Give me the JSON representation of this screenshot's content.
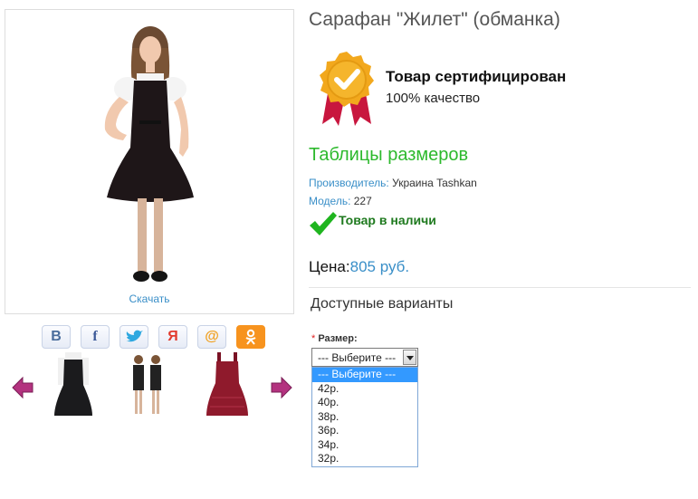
{
  "product": {
    "title": "Сарафан \"Жилет\" (обманка)",
    "download_label": "Скачать"
  },
  "certificate": {
    "title": "Товар сертифицирован",
    "subtitle": "100% качество",
    "icon": "certified-badge-icon"
  },
  "size_tables_link": "Таблицы размеров",
  "meta": {
    "manufacturer_label": "Производитель:",
    "manufacturer_value": "Украина Tashkan",
    "model_label": "Модель:",
    "model_value": "227"
  },
  "stock": {
    "text": "Товар в наличи",
    "icon": "checkmark-icon"
  },
  "price": {
    "label": "Цена:",
    "value": "805 руб."
  },
  "variants_title": "Доступные варианты",
  "size": {
    "required_mark": "*",
    "label": "Размер:",
    "selected": "--- Выберите ---",
    "options": [
      "--- Выберите ---",
      "42р.",
      "40р.",
      "38р.",
      "36р.",
      "34р.",
      "32р."
    ]
  },
  "share": [
    {
      "name": "vk",
      "glyph": "B",
      "color": "#4a6d9c"
    },
    {
      "name": "facebook",
      "glyph": "f",
      "color": "#3b5998"
    },
    {
      "name": "twitter",
      "glyph": "",
      "color": "#2fa8e0"
    },
    {
      "name": "my-world",
      "glyph": "Я",
      "color": "#e23b2e"
    },
    {
      "name": "mail",
      "glyph": "@",
      "color": "#f0a020"
    },
    {
      "name": "odnoklassniki",
      "glyph": "ОК",
      "color": "#f7931e"
    }
  ],
  "colors": {
    "accent": "#3a8fc8",
    "green": "#2db92d",
    "arrow": "#b3327f"
  }
}
